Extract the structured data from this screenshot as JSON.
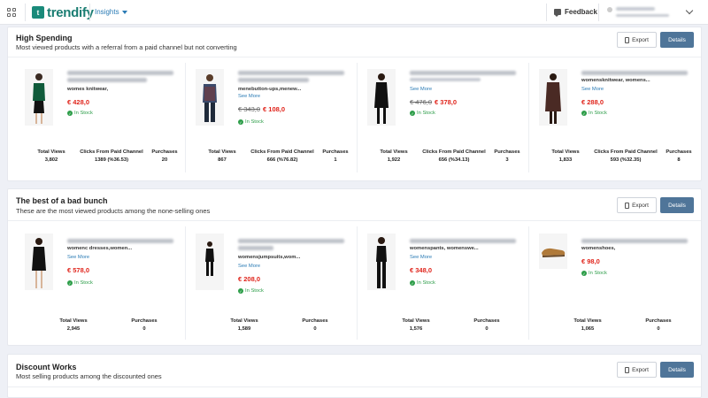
{
  "topbar": {
    "logo_mark": "t",
    "logo_text": "trendify",
    "menu_label": "Insights",
    "feedback_label": "Feedback"
  },
  "sections": [
    {
      "title": "High Spending",
      "subtitle": "Most viewed products with a referral from a paid channel but not converting",
      "export_label": "Export",
      "details_label": "Details",
      "stat_labels": [
        "Total Views",
        "Clicks From Paid Channel",
        "Purchases"
      ],
      "products": [
        {
          "category": "womes knitwear,",
          "see_more": "",
          "old_price": "",
          "price": "€ 428,0",
          "stock": "In Stock",
          "views": "3,802",
          "clicks": "1389 (%36.53)",
          "purchases": "20"
        },
        {
          "category": "menebutton-ups,menew...",
          "see_more": "See More",
          "old_price": "€ 343,0",
          "price": "€ 108,0",
          "stock": "In Stock",
          "views": "867",
          "clicks": "666 (%76.82)",
          "purchases": "1"
        },
        {
          "category": "",
          "see_more": "See More",
          "old_price": "€ 476,0",
          "price": "€ 378,0",
          "stock": "In Stock",
          "views": "1,922",
          "clicks": "656 (%34.13)",
          "purchases": "3"
        },
        {
          "category": "womensknitwear, womens...",
          "see_more": "See More",
          "old_price": "",
          "price": "€ 288,0",
          "stock": "In Stock",
          "views": "1,833",
          "clicks": "593 (%32.35)",
          "purchases": "8"
        }
      ]
    },
    {
      "title": "The best of a bad bunch",
      "subtitle": "These are the most viewed products among the none-selling ones",
      "export_label": "Export",
      "details_label": "Details",
      "stat_labels": [
        "Total Views",
        "Purchases"
      ],
      "products": [
        {
          "category": "womenc dresses,women...",
          "see_more": "See More",
          "old_price": "",
          "price": "€ 578,0",
          "stock": "In Stock",
          "views": "2,945",
          "purchases": "0"
        },
        {
          "category": "womensjumpsuits,wom...",
          "see_more": "See More",
          "old_price": "",
          "price": "€ 208,0",
          "stock": "In Stock",
          "views": "1,589",
          "purchases": "0"
        },
        {
          "category": "womenspants, womenswe...",
          "see_more": "See More",
          "old_price": "",
          "price": "€ 348,0",
          "stock": "In Stock",
          "views": "1,576",
          "purchases": "0"
        },
        {
          "category": "womenshoes,",
          "see_more": "",
          "old_price": "",
          "price": "€ 98,0",
          "stock": "In Stock",
          "views": "1,065",
          "purchases": "0"
        }
      ]
    },
    {
      "title": "Discount Works",
      "subtitle": "Most selling products among the discounted ones",
      "export_label": "Export",
      "details_label": "Details"
    }
  ],
  "colors": {
    "accent": "#1a7d72",
    "link": "#2a7bb5",
    "price": "#e0241b",
    "stock": "#2e9e4a",
    "details_button": "#4f7599"
  }
}
